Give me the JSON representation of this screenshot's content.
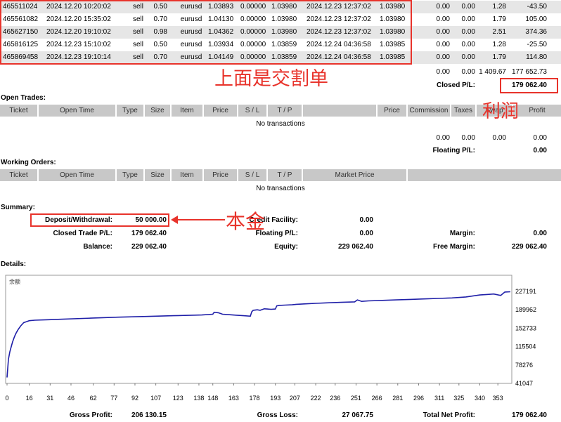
{
  "trades": [
    {
      "ticket": "465511024",
      "open_time": "2024.12.20 10:20:02",
      "type": "sell",
      "size": "0.50",
      "item": "eurusd",
      "price": "1.03893",
      "sl": "0.00000",
      "tp": "1.03980",
      "close_time": "2024.12.23 12:37:02",
      "close_price": "1.03980",
      "commission": "0.00",
      "taxes": "0.00",
      "swap": "1.28",
      "profit": "-43.50"
    },
    {
      "ticket": "465561082",
      "open_time": "2024.12.20 15:35:02",
      "type": "sell",
      "size": "0.70",
      "item": "eurusd",
      "price": "1.04130",
      "sl": "0.00000",
      "tp": "1.03980",
      "close_time": "2024.12.23 12:37:02",
      "close_price": "1.03980",
      "commission": "0.00",
      "taxes": "0.00",
      "swap": "1.79",
      "profit": "105.00"
    },
    {
      "ticket": "465627150",
      "open_time": "2024.12.20 19:10:02",
      "type": "sell",
      "size": "0.98",
      "item": "eurusd",
      "price": "1.04362",
      "sl": "0.00000",
      "tp": "1.03980",
      "close_time": "2024.12.23 12:37:02",
      "close_price": "1.03980",
      "commission": "0.00",
      "taxes": "0.00",
      "swap": "2.51",
      "profit": "374.36"
    },
    {
      "ticket": "465816125",
      "open_time": "2024.12.23 15:10:02",
      "type": "sell",
      "size": "0.50",
      "item": "eurusd",
      "price": "1.03934",
      "sl": "0.00000",
      "tp": "1.03859",
      "close_time": "2024.12.24 04:36:58",
      "close_price": "1.03985",
      "commission": "0.00",
      "taxes": "0.00",
      "swap": "1.28",
      "profit": "-25.50"
    },
    {
      "ticket": "465869458",
      "open_time": "2024.12.23 19:10:14",
      "type": "sell",
      "size": "0.70",
      "item": "eurusd",
      "price": "1.04149",
      "sl": "0.00000",
      "tp": "1.03859",
      "close_time": "2024.12.24 04:36:58",
      "close_price": "1.03985",
      "commission": "0.00",
      "taxes": "0.00",
      "swap": "1.79",
      "profit": "114.80"
    }
  ],
  "closed_totals": {
    "commission": "0.00",
    "taxes": "0.00",
    "swap": "1 409.67",
    "profit": "177 652.73"
  },
  "closed_pl": {
    "label": "Closed P/L:",
    "value": "179 062.40"
  },
  "annotations": {
    "closed_orders": "上面是交割单",
    "profit": "利润",
    "capital": "本金"
  },
  "open_trades": {
    "title": "Open Trades:",
    "headers": [
      "Ticket",
      "Open Time",
      "Type",
      "Size",
      "Item",
      "Price",
      "S / L",
      "T / P",
      "",
      "Price",
      "Commission",
      "Taxes",
      "Swap",
      "Profit"
    ],
    "empty": "No transactions",
    "totals": {
      "commission": "0.00",
      "taxes": "0.00",
      "swap": "0.00",
      "profit": "0.00"
    },
    "floating_label": "Floating P/L:",
    "floating_value": "0.00"
  },
  "working_orders": {
    "title": "Working Orders:",
    "headers": [
      "Ticket",
      "Open Time",
      "Type",
      "Size",
      "Item",
      "Price",
      "S / L",
      "T / P",
      "Market Price"
    ],
    "empty": "No transactions"
  },
  "summary": {
    "title": "Summary:",
    "deposit_label": "Deposit/Withdrawal:",
    "deposit_value": "50 000.00",
    "credit_label": "Credit Facility:",
    "credit_value": "0.00",
    "closed_trade_label": "Closed Trade P/L:",
    "closed_trade_value": "179 062.40",
    "floating_label": "Floating P/L:",
    "floating_value": "0.00",
    "margin_label": "Margin:",
    "margin_value": "0.00",
    "balance_label": "Balance:",
    "balance_value": "229 062.40",
    "equity_label": "Equity:",
    "equity_value": "229 062.40",
    "free_margin_label": "Free Margin:",
    "free_margin_value": "229 062.40"
  },
  "details": {
    "title": "Details:"
  },
  "footer": {
    "gross_profit_label": "Gross Profit:",
    "gross_profit_value": "206 130.15",
    "gross_loss_label": "Gross Loss:",
    "gross_loss_value": "27 067.75",
    "net_profit_label": "Total Net Profit:",
    "net_profit_value": "179 062.40"
  },
  "chart_data": {
    "type": "line",
    "title": "余额",
    "line_color": "#1f1fa8",
    "xlim": [
      0,
      362
    ],
    "ylim": [
      41047,
      240000
    ],
    "x_ticks": [
      0,
      16,
      31,
      46,
      62,
      77,
      92,
      107,
      123,
      138,
      148,
      163,
      178,
      193,
      207,
      222,
      236,
      251,
      266,
      281,
      296,
      311,
      325,
      340,
      353
    ],
    "y_ticks": [
      41047,
      78276,
      115504,
      152733,
      189962,
      227191
    ],
    "x": [
      0,
      1,
      2,
      3,
      4,
      5,
      6,
      7,
      8,
      9,
      10,
      11,
      12,
      14,
      16,
      20,
      30,
      40,
      60,
      80,
      100,
      120,
      140,
      148,
      149,
      152,
      155,
      160,
      165,
      170,
      175,
      176,
      177,
      180,
      182,
      185,
      190,
      193,
      194,
      196,
      200,
      205,
      208,
      215,
      222,
      230,
      240,
      250,
      252,
      255,
      260,
      270,
      280,
      290,
      300,
      310,
      320,
      330,
      340,
      345,
      350,
      355,
      358,
      362
    ],
    "y": [
      53000,
      90000,
      105000,
      115000,
      125000,
      133000,
      140000,
      145000,
      150000,
      154000,
      158000,
      161000,
      164000,
      166000,
      168000,
      169000,
      170000,
      171000,
      173000,
      175000,
      176500,
      178000,
      179500,
      181000,
      185000,
      184000,
      181000,
      180000,
      179000,
      178000,
      177000,
      186000,
      189000,
      190000,
      189000,
      192000,
      191000,
      191500,
      198000,
      199000,
      199500,
      200000,
      201000,
      202000,
      203000,
      204000,
      205000,
      206000,
      210000,
      207000,
      208000,
      209000,
      210000,
      211000,
      212000,
      213000,
      214000,
      216000,
      220000,
      221000,
      222000,
      219000,
      226000,
      226500
    ]
  }
}
